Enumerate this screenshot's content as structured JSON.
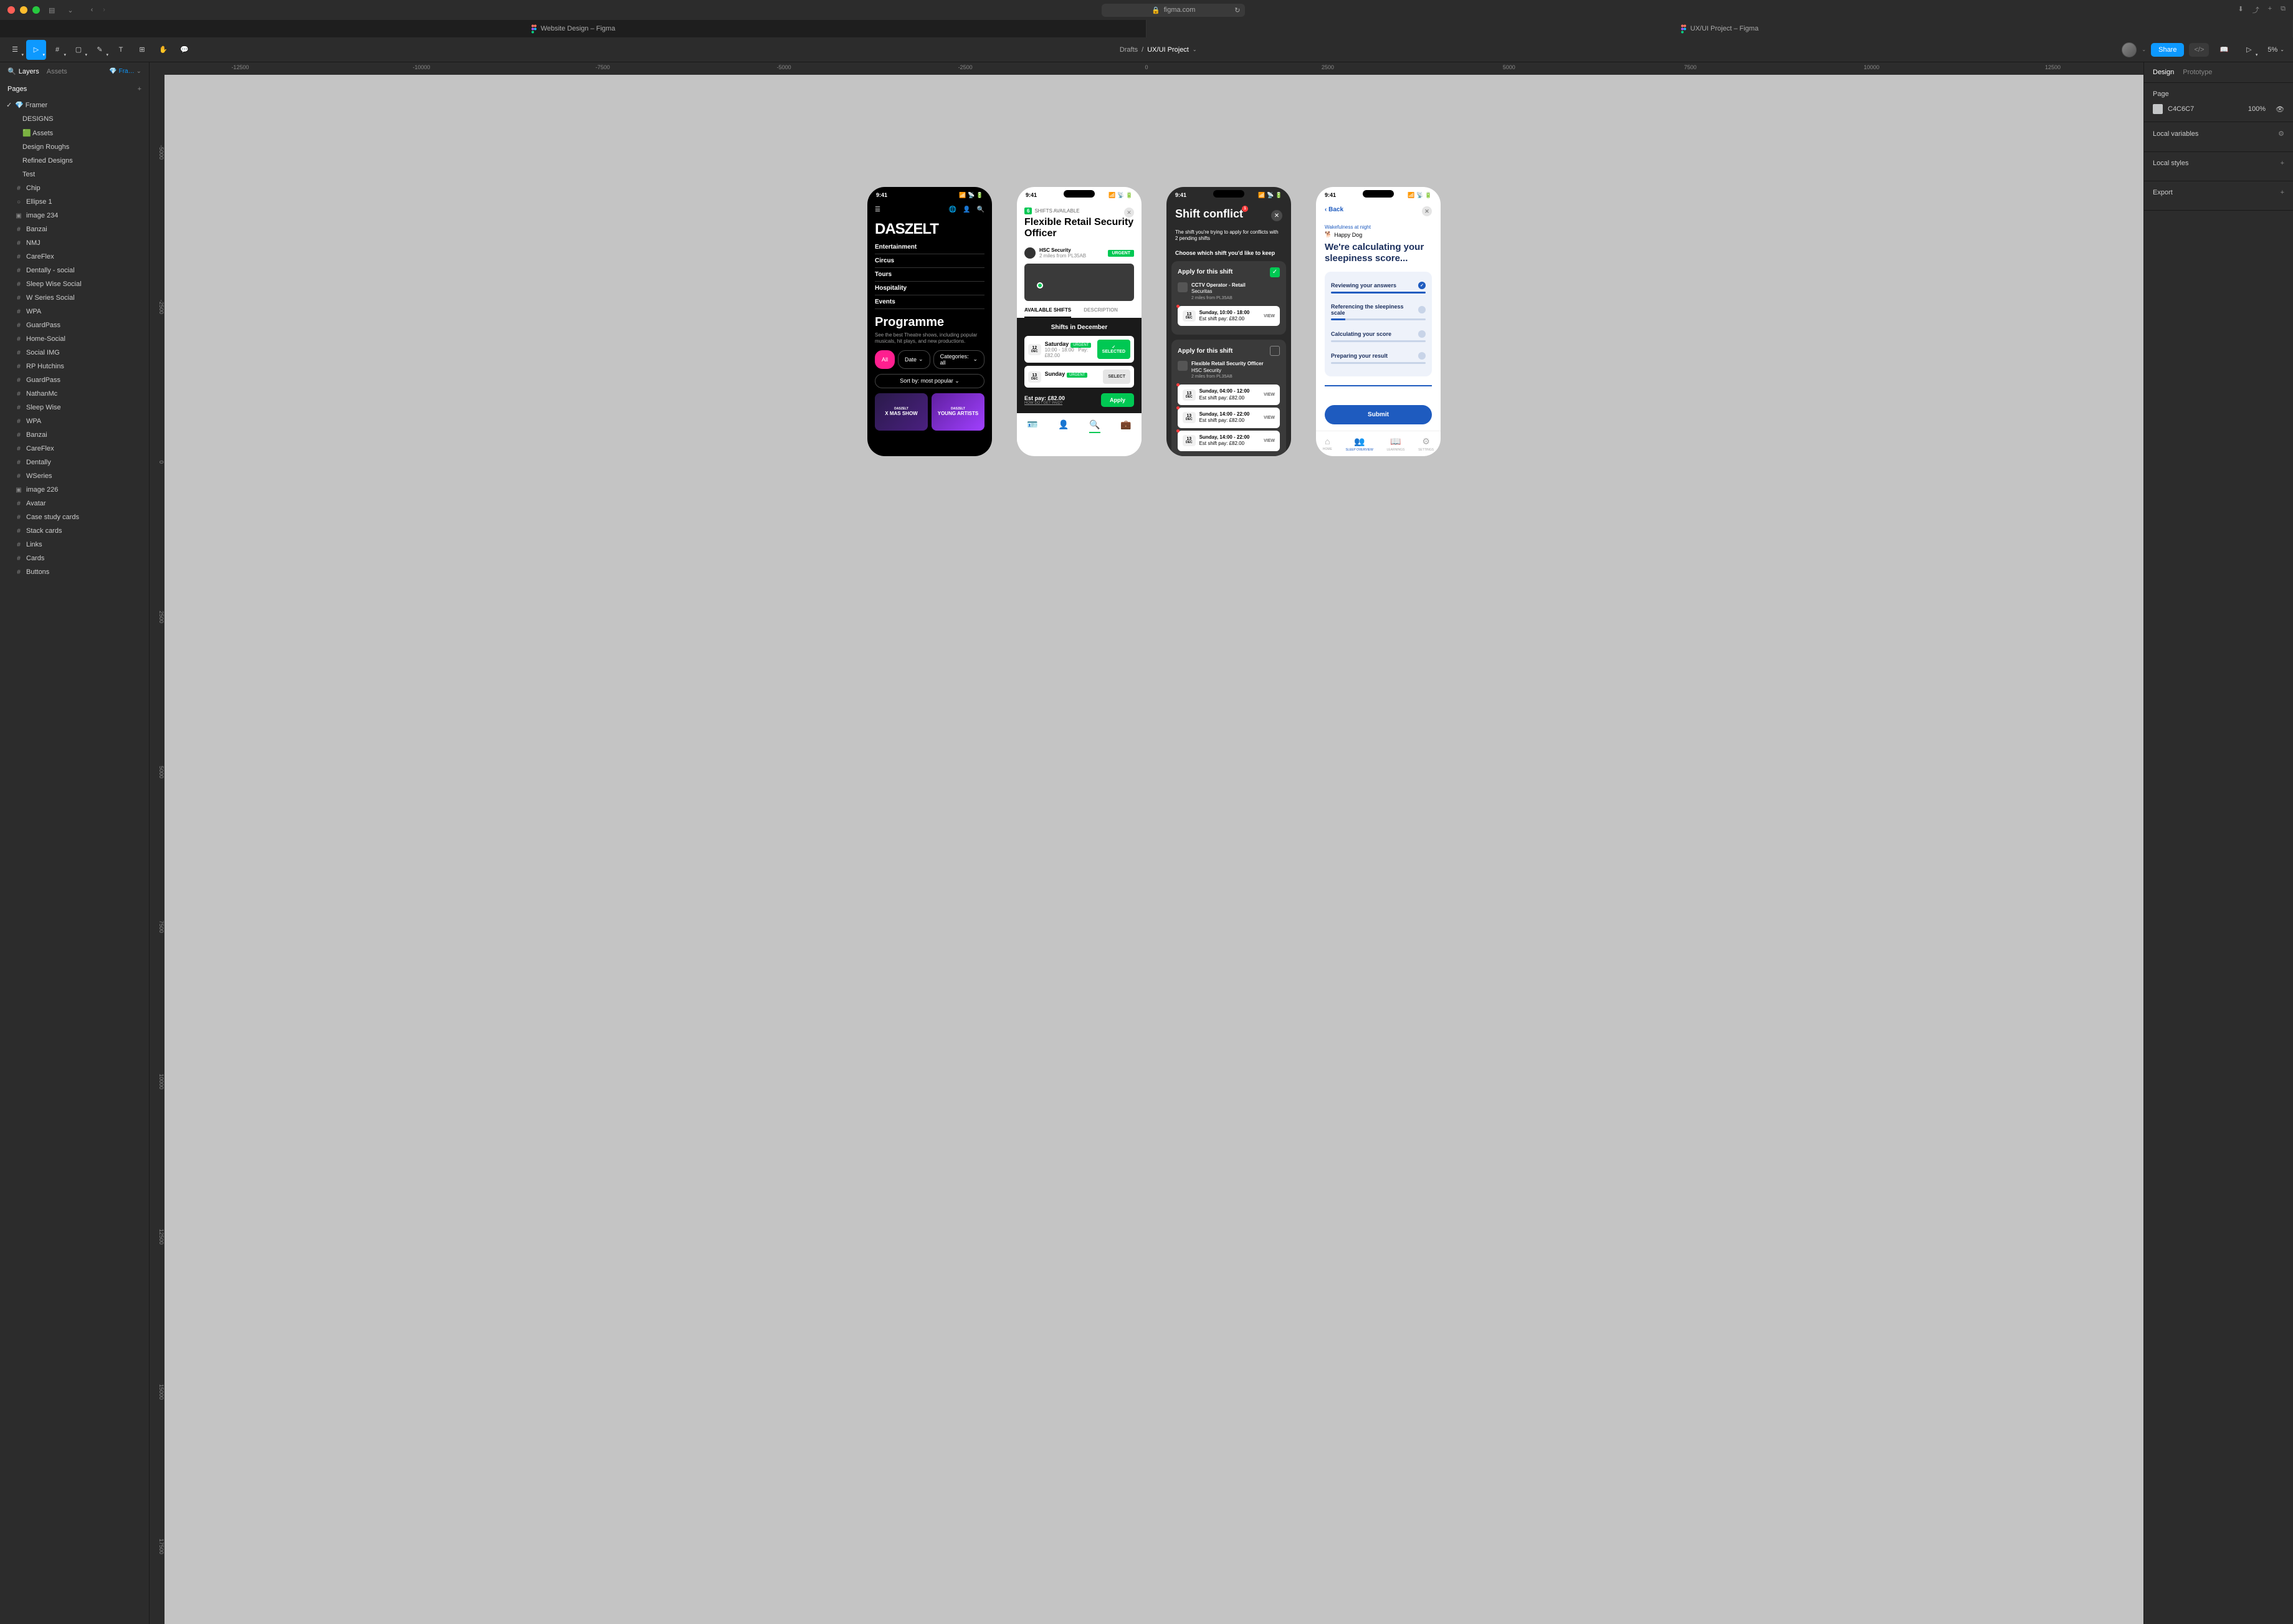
{
  "chrome": {
    "url": "figma.com",
    "tabs": [
      {
        "label": "Website Design – Figma",
        "active": false
      },
      {
        "label": "UX/UI Project – Figma",
        "active": true
      }
    ]
  },
  "toolbar": {
    "breadcrumb_root": "Drafts",
    "breadcrumb_project": "UX/UI Project",
    "share": "Share",
    "zoom": "5%"
  },
  "left_panel": {
    "tabs": {
      "layers": "Layers",
      "assets": "Assets"
    },
    "filter": "Fra…",
    "pages_header": "Pages",
    "pages": [
      {
        "label": "Framer",
        "active": true,
        "icon": "💎"
      },
      {
        "label": "DESIGNS",
        "indent": true
      },
      {
        "label": "Assets",
        "indent": true,
        "icon": "🟩"
      },
      {
        "label": "Design Roughs",
        "indent": true
      },
      {
        "label": "Refined Designs",
        "indent": true
      },
      {
        "label": "Test",
        "indent": true
      }
    ],
    "layers": [
      {
        "label": "Chip",
        "icon": "frame"
      },
      {
        "label": "Ellipse 1",
        "icon": "ellipse"
      },
      {
        "label": "image 234",
        "icon": "image"
      },
      {
        "label": "Banzai",
        "icon": "frame"
      },
      {
        "label": "NMJ",
        "icon": "frame"
      },
      {
        "label": "CareFlex",
        "icon": "frame"
      },
      {
        "label": "Dentally - social",
        "icon": "frame"
      },
      {
        "label": "Sleep Wise Social",
        "icon": "frame"
      },
      {
        "label": "W Series Social",
        "icon": "frame"
      },
      {
        "label": "WPA",
        "icon": "frame"
      },
      {
        "label": "GuardPass",
        "icon": "frame"
      },
      {
        "label": "Home-Social",
        "icon": "frame"
      },
      {
        "label": "Social IMG",
        "icon": "frame"
      },
      {
        "label": "RP Hutchins",
        "icon": "frame"
      },
      {
        "label": "GuardPass",
        "icon": "frame"
      },
      {
        "label": "NathanMc",
        "icon": "frame"
      },
      {
        "label": "Sleep Wise",
        "icon": "frame"
      },
      {
        "label": "WPA",
        "icon": "frame"
      },
      {
        "label": "Banzai",
        "icon": "frame"
      },
      {
        "label": "CareFlex",
        "icon": "frame"
      },
      {
        "label": "Dentally",
        "icon": "frame"
      },
      {
        "label": "WSeries",
        "icon": "frame"
      },
      {
        "label": "image 226",
        "icon": "image"
      },
      {
        "label": "Avatar",
        "icon": "frame"
      },
      {
        "label": "Case study cards",
        "icon": "frame"
      },
      {
        "label": "Stack cards",
        "icon": "frame"
      },
      {
        "label": "Links",
        "icon": "frame"
      },
      {
        "label": "Cards",
        "icon": "frame"
      },
      {
        "label": "Buttons",
        "icon": "frame"
      }
    ]
  },
  "rulers": {
    "h": [
      "-12500",
      "-10000",
      "-7500",
      "-5000",
      "-2500",
      "0",
      "2500",
      "5000",
      "7500",
      "10000",
      "12500"
    ],
    "v": [
      "-5000",
      "-2500",
      "0",
      "2500",
      "5000",
      "7500",
      "10000",
      "12500",
      "15000",
      "17500"
    ]
  },
  "right_panel": {
    "tabs": {
      "design": "Design",
      "prototype": "Prototype"
    },
    "page_label": "Page",
    "color_hex": "C4C6C7",
    "color_opacity": "100%",
    "local_vars": "Local variables",
    "local_styles": "Local styles",
    "export": "Export"
  },
  "phone_time": "9:41",
  "phone1": {
    "logo": "DASZELT",
    "nav": [
      "Entertainment",
      "Circus",
      "Tours",
      "Hospitality",
      "Events"
    ],
    "title": "Programme",
    "subtitle": "See the best Theatre shows, including popular musicals, hit plays, and new productions.",
    "chips": {
      "all": "All",
      "date": "Date",
      "cat": "Categories: all"
    },
    "sort": "Sort by: most popular",
    "card1_top": "DASZELT",
    "card1_bot": "X MAS SHOW",
    "card2_top": "DASZELT",
    "card2_bot": "YOUNG ARTISTS"
  },
  "phone2": {
    "shifts_badge_num": "6",
    "shifts_badge": "SHIFTS AVAILABLE",
    "title": "Flexible Retail Security Officer",
    "company": "HSC Security",
    "miles": "2 miles from PL35AB",
    "urgent": "URGENT",
    "tab1": "AVAILABLE SHIFTS",
    "tab2": "DESCRIPTION",
    "section_title": "Shifts in December",
    "shifts": [
      {
        "num": "12",
        "mon": "DEC",
        "day": "Saturday",
        "time": "10:00 - 18:00",
        "pay": "Pay: £82.00",
        "btn": "SELECTED",
        "urgent": true,
        "selected": true
      },
      {
        "num": "13",
        "mon": "DEC",
        "day": "Sunday",
        "time": "",
        "pay": "",
        "btn": "SELECT",
        "urgent": true,
        "selected": false
      }
    ],
    "est_pay": "Est pay: £82.00",
    "est_sub": "HOW DO I GET PAID?",
    "apply": "Apply"
  },
  "phone3": {
    "title": "Shift conflict",
    "badge": "1",
    "subtitle": "The shift you're trying to apply for conflicts with 2 pending shifts",
    "choose": "Choose which shift you'd like to keep",
    "card1": {
      "title": "Apply for this shift",
      "role": "CCTV Operator - Retail",
      "company": "Securitas",
      "miles": "2 miles from PL35AB",
      "shift": {
        "num": "13",
        "mon": "DEC",
        "day": "Sunday, 10:00 - 18:00",
        "pay": "Est shift pay: £82.00",
        "view": "VIEW"
      }
    },
    "card2": {
      "title": "Apply for this shift",
      "role": "Flexible Retail Security Officer",
      "company": "HSC Security",
      "miles": "2 miles from PL35AB",
      "shifts": [
        {
          "num": "13",
          "mon": "DEC",
          "day": "Sunday, 04:00 - 12:00",
          "pay": "Est shift pay: £82.00",
          "view": "VIEW"
        },
        {
          "num": "13",
          "mon": "DEC",
          "day": "Sunday, 14:00 - 22:00",
          "pay": "Est shift pay: £82.00",
          "view": "VIEW"
        },
        {
          "num": "13",
          "mon": "DEC",
          "day": "Sunday, 14:00 - 22:00",
          "pay": "Est shift pay: £82.00",
          "view": "VIEW"
        }
      ]
    }
  },
  "phone4": {
    "back": "Back",
    "tiny": "Wakefulness at night",
    "dog": "Happy Dog",
    "title": "We're calculating your sleepiness score...",
    "steps": [
      {
        "label": "Reviewing your answers",
        "done": true,
        "pct": 100
      },
      {
        "label": "Referencing the sleepiness scale",
        "done": false,
        "pct": 15
      },
      {
        "label": "Calculating your score",
        "done": false,
        "pct": 0
      },
      {
        "label": "Preparing your result",
        "done": false,
        "pct": 0
      }
    ],
    "submit": "Submit",
    "nav": [
      "HOME",
      "SLEEP OVERVIEW",
      "LEARNINGS",
      "SETTINGS"
    ]
  }
}
